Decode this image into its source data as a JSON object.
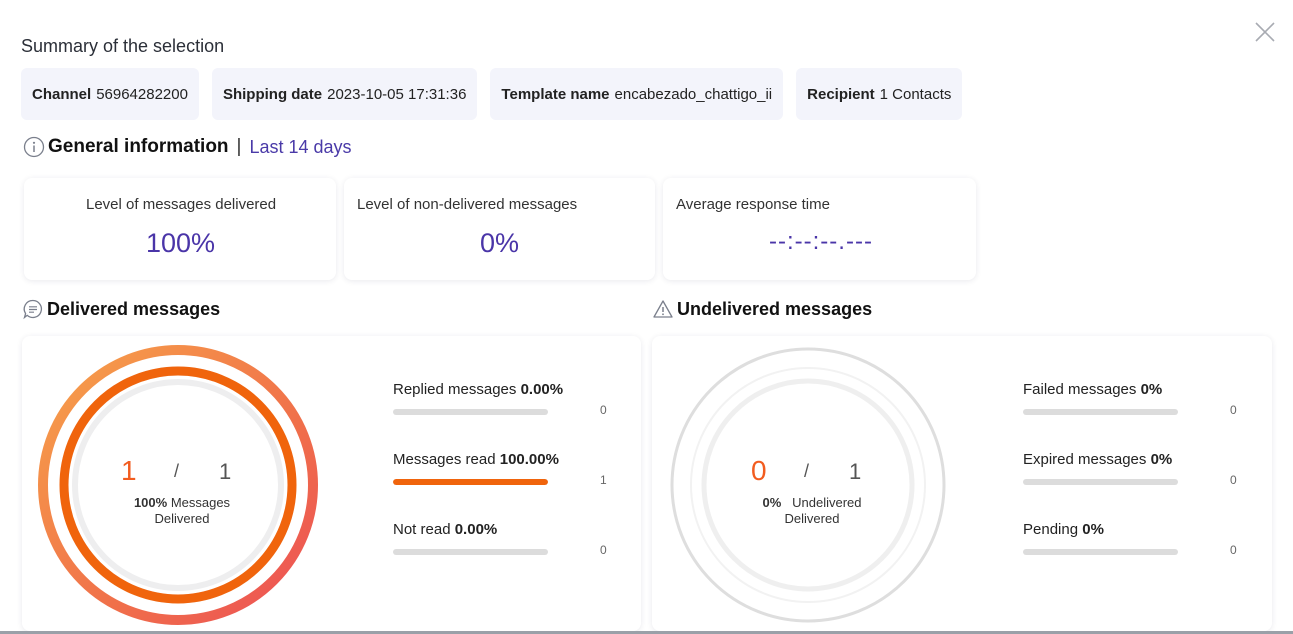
{
  "modal": {
    "title": "Summary of the selection",
    "close_icon": "close-icon"
  },
  "chips": [
    {
      "key": "Channel",
      "value": "56964282200"
    },
    {
      "key": "Shipping date",
      "value": "2023-10-05 17:31:36"
    },
    {
      "key": "Template name",
      "value": "encabezado_chattigo_ii"
    },
    {
      "key": "Recipient",
      "value": "1 Contacts"
    }
  ],
  "general": {
    "icon": "info-icon",
    "title": "General information",
    "separator": "|",
    "range": "Last 14 days",
    "kpis": [
      {
        "label": "Level of messages delivered",
        "value": "100%"
      },
      {
        "label": "Level of non-delivered messages",
        "value": "0%"
      },
      {
        "label": "Average response time",
        "value": "--:--:--.---"
      }
    ]
  },
  "delivered": {
    "icon": "chat-bubble-icon",
    "title": "Delivered messages",
    "count": "1",
    "slash": "/",
    "total": "1",
    "percent": "100%",
    "sub_label": "Messages",
    "sub_label_2": "Delivered",
    "fraction": 1.0,
    "metrics": [
      {
        "label": "Replied messages",
        "pct": "0.00%",
        "count": "0",
        "fraction": 0
      },
      {
        "label": "Messages read",
        "pct": "100.00%",
        "count": "1",
        "fraction": 1
      },
      {
        "label": "Not read",
        "pct": "0.00%",
        "count": "0",
        "fraction": 0
      }
    ]
  },
  "undelivered": {
    "icon": "warning-triangle-icon",
    "title": "Undelivered messages",
    "count": "0",
    "slash": "/",
    "total": "1",
    "percent": "0%",
    "sub_label": "Undelivered",
    "sub_label_2": "Delivered",
    "fraction": 0,
    "metrics": [
      {
        "label": "Failed messages",
        "pct": "0%",
        "count": "0",
        "fraction": 0
      },
      {
        "label": "Expired messages",
        "pct": "0%",
        "count": "0",
        "fraction": 0
      },
      {
        "label": "Pending",
        "pct": "0%",
        "count": "0",
        "fraction": 0
      }
    ]
  },
  "colors": {
    "accent": "#4a35a8",
    "orange": "#f0640c",
    "count_red": "#f25c1f",
    "track": "#dcdcdc"
  }
}
